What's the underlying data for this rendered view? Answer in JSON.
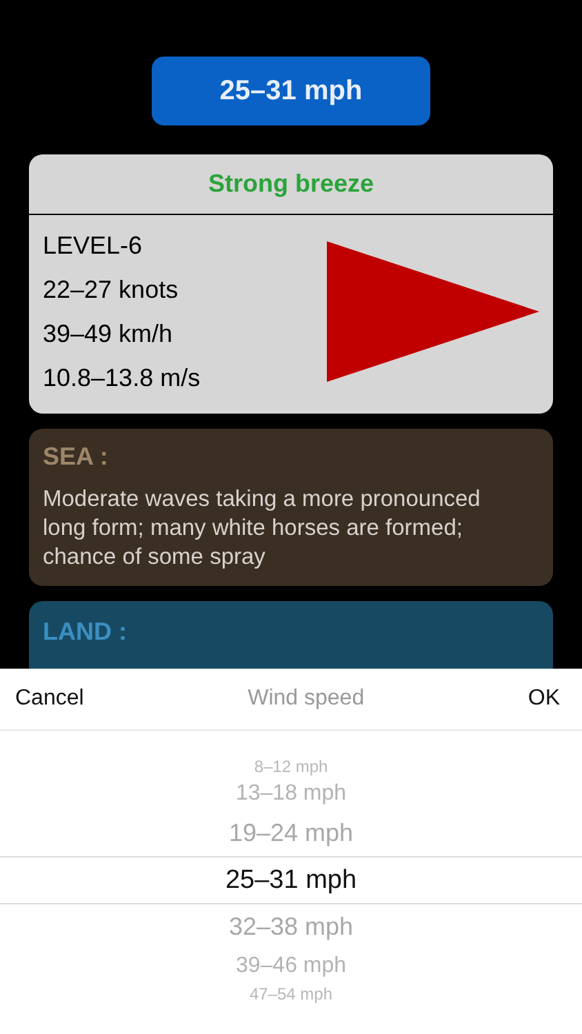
{
  "speed_button": {
    "label": "25–31 mph"
  },
  "beaufort_card": {
    "title": "Strong breeze",
    "lines": [
      "LEVEL-6",
      "22–27 knots",
      "39–49 km/h",
      "10.8–13.8 m/s"
    ]
  },
  "sea_card": {
    "heading": "SEA :",
    "text": "Moderate waves taking a more pronounced long form; many white horses are formed; chance of some spray"
  },
  "land_card": {
    "heading": "LAND :"
  },
  "picker_sheet": {
    "cancel": "Cancel",
    "title": "Wind speed",
    "ok": "OK",
    "items": [
      {
        "label": "8–12 mph",
        "selected": false
      },
      {
        "label": "13–18 mph",
        "selected": false
      },
      {
        "label": "19–24 mph",
        "selected": false
      },
      {
        "label": "25–31 mph",
        "selected": true
      },
      {
        "label": "32–38 mph",
        "selected": false
      },
      {
        "label": "39–46 mph",
        "selected": false
      },
      {
        "label": "47–54 mph",
        "selected": false
      }
    ]
  }
}
